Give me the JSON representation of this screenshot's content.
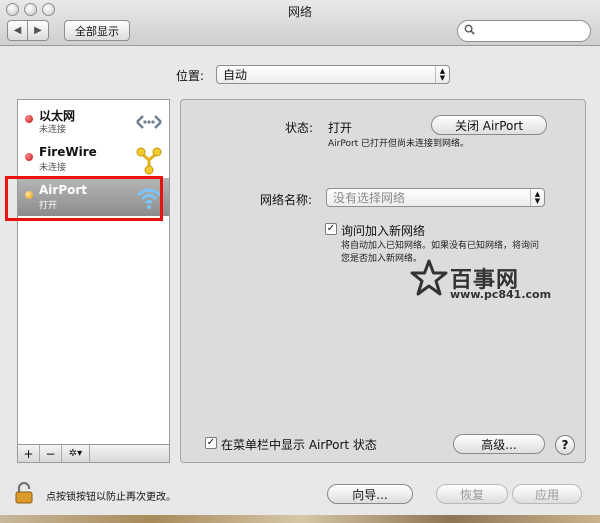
{
  "window": {
    "title": "网络"
  },
  "toolbar": {
    "back": "◀",
    "forward": "▶",
    "show_all": "全部显示",
    "search_placeholder": ""
  },
  "location": {
    "label": "位置:",
    "value": "自动"
  },
  "services": [
    {
      "name": "以太网",
      "status": "未连接",
      "dot_color": "#d01818",
      "icon": "ethernet-icon"
    },
    {
      "name": "FireWire",
      "status": "未连接",
      "dot_color": "#d01818",
      "icon": "firewire-icon"
    },
    {
      "name": "AirPort",
      "status": "打开",
      "dot_color": "#f2b01e",
      "icon": "wifi-icon",
      "selected": true
    }
  ],
  "sidebar_tools": {
    "add": "+",
    "remove": "−",
    "gear": "✲▾"
  },
  "detail": {
    "status_label": "状态:",
    "status_value": "打开",
    "toggle_button": "关闭 AirPort",
    "status_desc": "AirPort 已打开但尚未连接到网络。",
    "network_name_label": "网络名称:",
    "network_name_placeholder": "没有选择网络",
    "ask_join_label": "询问加入新网络",
    "ask_join_checked": true,
    "ask_join_desc_line1": "将自动加入已知网络。如果没有已知网络，将询问",
    "ask_join_desc_line2": "您是否加入新网络。",
    "show_menubar_label": "在菜单栏中显示 AirPort 状态",
    "show_menubar_checked": true,
    "advanced_button": "高级...",
    "help": "?"
  },
  "watermark": {
    "brand": "百事网",
    "url": "www.pc841.com"
  },
  "footer": {
    "lock_text": "点按锁按钮以防止再次更改。",
    "assist_button": "向导...",
    "revert_button": "恢复",
    "apply_button": "应用"
  },
  "colors": {
    "highlight_border": "#e11111",
    "wifi": "#5aa9e6"
  }
}
